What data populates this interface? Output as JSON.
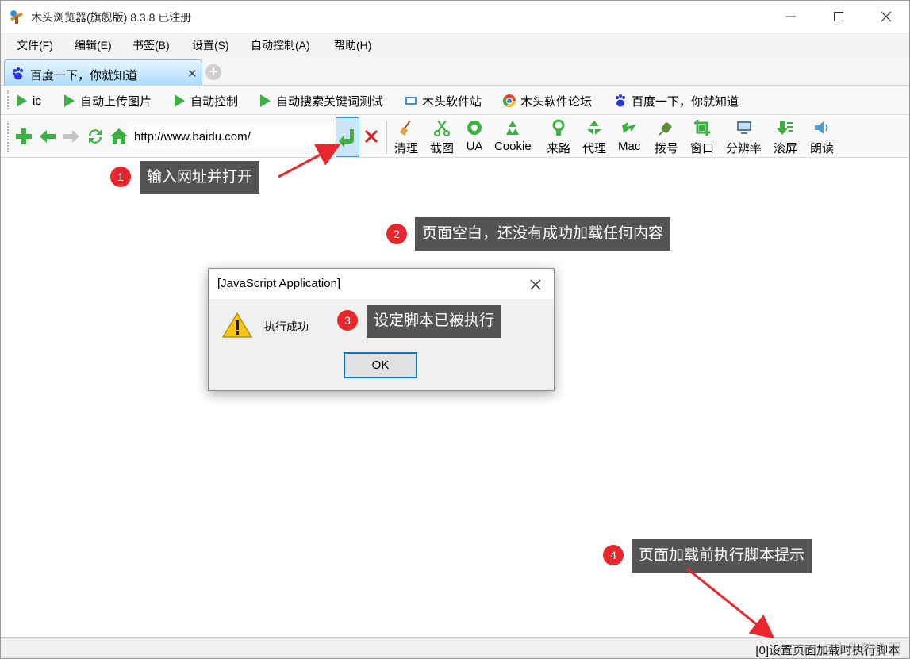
{
  "window": {
    "title": "木头浏览器(旗舰版) 8.3.8  已注册",
    "controls": [
      "minimize",
      "maximize",
      "close"
    ]
  },
  "menu": [
    "文件(F)",
    "编辑(E)",
    "书签(B)",
    "设置(S)",
    "自动控制(A)",
    "帮助(H)"
  ],
  "tab": {
    "title": "百度一下，你就知道",
    "close": "✕",
    "new_tab": "+"
  },
  "bookmarks": [
    "ic",
    "自动上传图片",
    "自动控制",
    "自动搜索关键词测试",
    "木头软件站",
    "木头软件论坛",
    "百度一下，你就知道"
  ],
  "address": {
    "url": "http://www.baidu.com/"
  },
  "tools": [
    "清理",
    "截图",
    "UA",
    "Cookie",
    "来路",
    "代理",
    "Mac",
    "拨号",
    "窗口",
    "分辨率",
    "滚屏",
    "朗读"
  ],
  "dialog": {
    "title": "[JavaScript Application]",
    "message": "执行成功",
    "ok_label": "OK"
  },
  "status": {
    "text": "[0]设置页面加载时执行脚本",
    "watermark": "CSDN @木头软件园"
  },
  "annotations": [
    {
      "num": "1",
      "text": "输入网址并打开"
    },
    {
      "num": "2",
      "text": "页面空白，还没有成功加载任何内容"
    },
    {
      "num": "3",
      "text": "设定脚本已被执行"
    },
    {
      "num": "4",
      "text": "页面加载前执行脚本提示"
    }
  ],
  "colors": {
    "badge": "#e8272c",
    "callout": "#545454",
    "arrow": "#e8272c",
    "tab_active": "#a9dcfb",
    "bookmark_play": "#3cb043"
  }
}
